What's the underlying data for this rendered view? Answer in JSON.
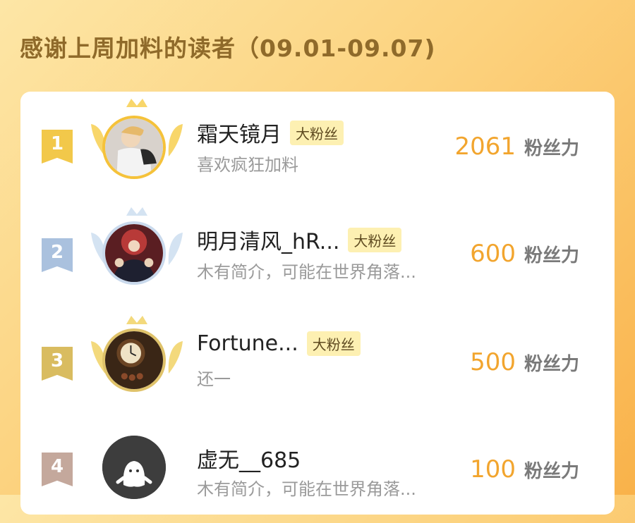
{
  "header": {
    "title": "感谢上周加料的读者（09.01-09.07)"
  },
  "colors": {
    "accent": "#f2a52e",
    "badge_bg": "#fdf0b2",
    "gold": "#f5c23a",
    "silver": "#c9d9ec",
    "bronze": "#dfc26a"
  },
  "leaderboard": [
    {
      "rank": "1",
      "name": "霜天镜月",
      "badge": "大粉丝",
      "description": "喜欢疯狂加料",
      "points": "2061",
      "unit": "粉丝力"
    },
    {
      "rank": "2",
      "name": "明月清风_hR...",
      "badge": "大粉丝",
      "description": "木有简介，可能在世界角落...",
      "points": "600",
      "unit": "粉丝力"
    },
    {
      "rank": "3",
      "name": "Fortune...",
      "badge": "大粉丝",
      "description": "还一",
      "points": "500",
      "unit": "粉丝力"
    },
    {
      "rank": "4",
      "name": "虚无__685",
      "description": "木有简介，可能在世界角落...",
      "points": "100",
      "unit": "粉丝力"
    }
  ]
}
